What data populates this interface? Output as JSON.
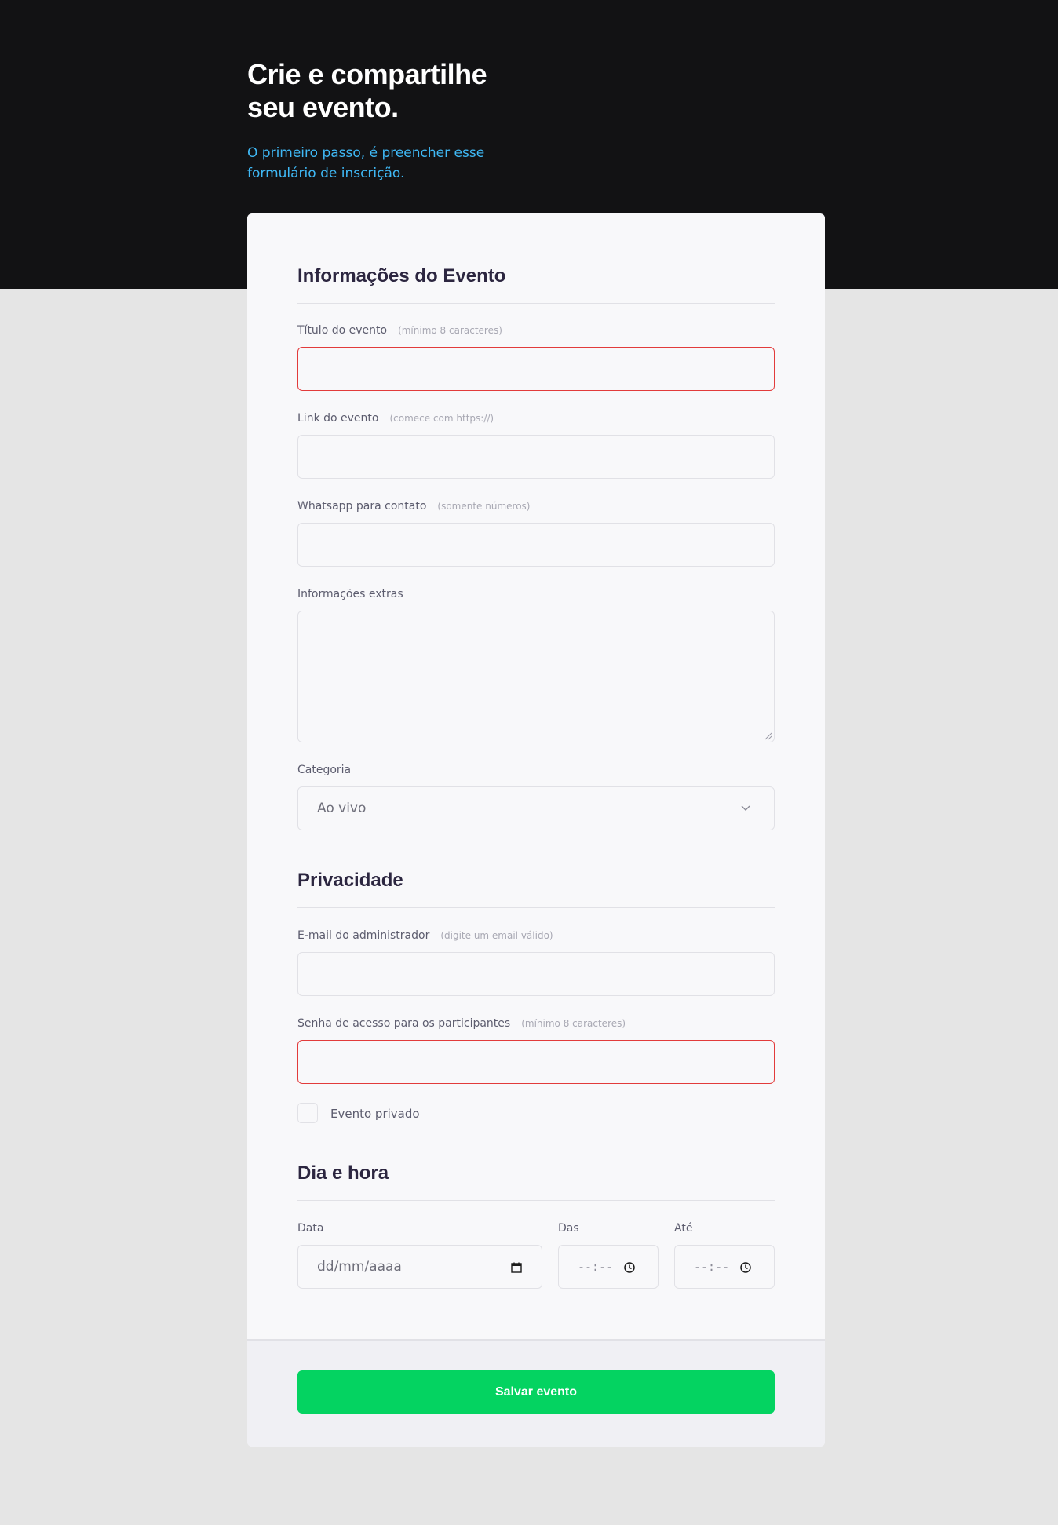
{
  "hero": {
    "title": "Crie e compartilhe seu evento.",
    "subtitle": "O primeiro passo, é preencher esse formulário de inscrição."
  },
  "sections": {
    "event_info": "Informações do Evento",
    "privacy": "Privacidade",
    "date_time": "Dia e hora"
  },
  "fields": {
    "title": {
      "label": "Título do evento",
      "hint": "(mínimo 8 caracteres)",
      "value": ""
    },
    "link": {
      "label": "Link do evento",
      "hint": "(comece com https://)",
      "value": ""
    },
    "whatsapp": {
      "label": "Whatsapp para contato",
      "hint": "(somente números)",
      "value": ""
    },
    "extra": {
      "label": "Informações extras",
      "value": ""
    },
    "category": {
      "label": "Categoria",
      "value": "Ao vivo"
    },
    "admin_email": {
      "label": "E-mail do administrador",
      "hint": "(digite um email válido)",
      "value": ""
    },
    "password": {
      "label": "Senha de acesso para os participantes",
      "hint": "(mínimo 8 caracteres)",
      "value": ""
    },
    "private": {
      "label": "Evento privado",
      "checked": false
    },
    "date": {
      "label": "Data",
      "placeholder": "dd/mm/aaaa"
    },
    "from": {
      "label": "Das",
      "placeholder": "--:--"
    },
    "to": {
      "label": "Até",
      "placeholder": "--:--"
    }
  },
  "footer": {
    "save_label": "Salvar evento"
  },
  "colors": {
    "hero_bg": "#121214",
    "accent_blue": "#3fb8f5",
    "error_border": "#e23b3b",
    "save_green": "#04d361"
  },
  "icons": {
    "select": "chevron-down-icon",
    "date": "calendar-icon",
    "time": "clock-icon"
  }
}
